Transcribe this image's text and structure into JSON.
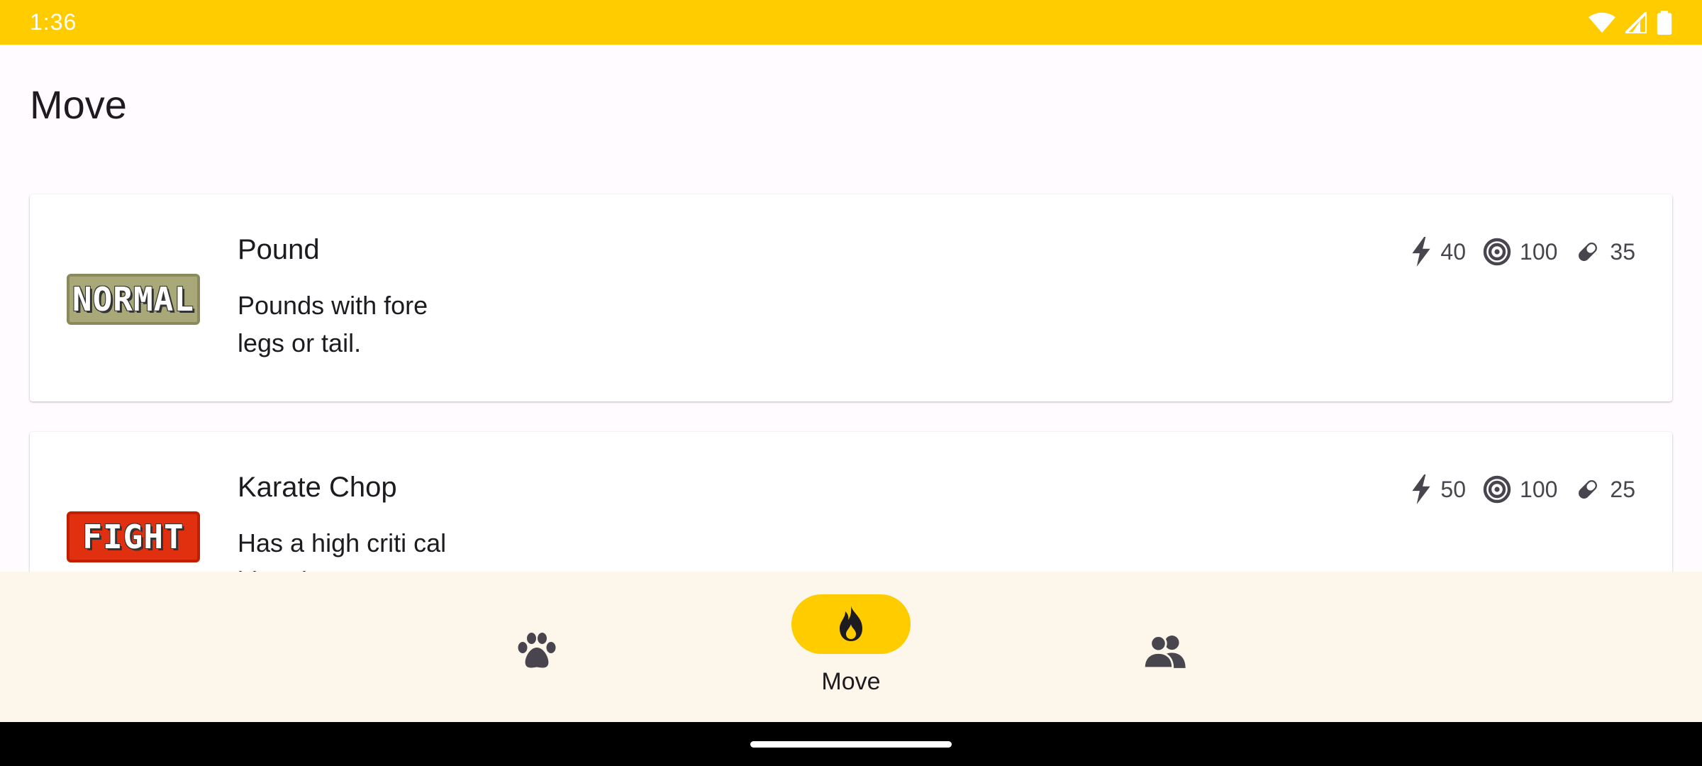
{
  "status_bar": {
    "time": "1:36"
  },
  "app": {
    "title": "Move"
  },
  "moves": [
    {
      "name": "Pound",
      "type_badge": "NORMAL",
      "description": "Pounds with fore legs or tail.",
      "power": "40",
      "accuracy": "100",
      "pp": "35"
    },
    {
      "name": "Karate Chop",
      "type_badge": "FIGHT",
      "description": "Has a high criti cal hit ratio.",
      "power": "50",
      "accuracy": "100",
      "pp": "25"
    }
  ],
  "bottom_nav": {
    "items": [
      {
        "icon": "paw-icon",
        "label": ""
      },
      {
        "icon": "flame-icon",
        "label": "Move",
        "active": true
      },
      {
        "icon": "group-icon",
        "label": ""
      }
    ]
  }
}
